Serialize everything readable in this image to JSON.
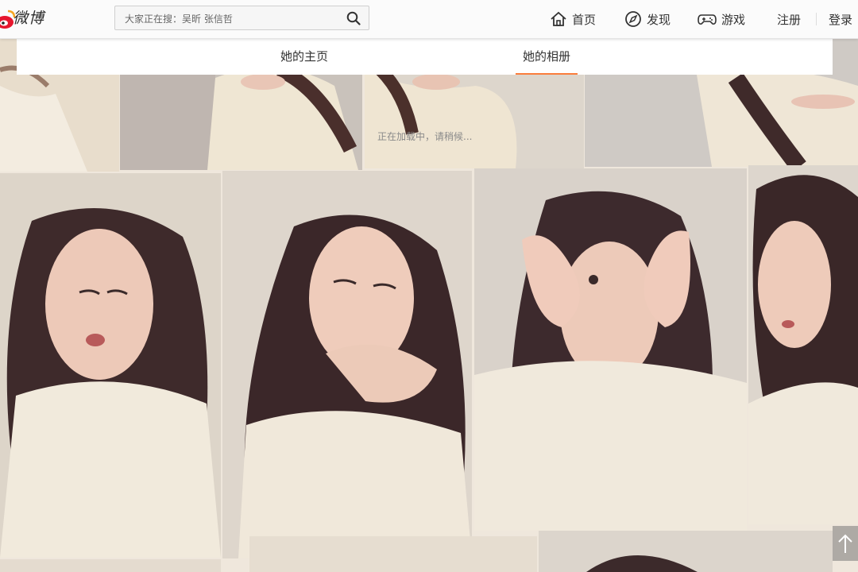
{
  "header": {
    "logo_text": "微博",
    "search_placeholder": "大家正在搜：吴昕 张信哲",
    "nav": {
      "home": "首页",
      "discover": "发现",
      "games": "游戏",
      "register": "注册",
      "login": "登录"
    }
  },
  "tabs": {
    "home": "她的主页",
    "album": "她的相册",
    "active": "album"
  },
  "album": {
    "loading_text": "正在加载中，请稍候..."
  },
  "colors": {
    "accent": "#fa7d3c",
    "weibo_red": "#e6162d"
  }
}
